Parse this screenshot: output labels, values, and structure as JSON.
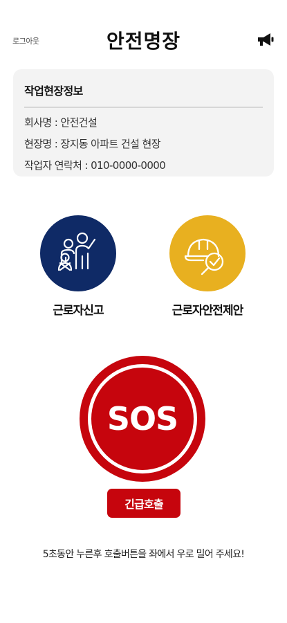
{
  "header": {
    "logout_label": "로그아웃",
    "title": "안전명장",
    "megaphone_icon": "megaphone-icon"
  },
  "info_card": {
    "title": "작업현장정보",
    "rows": [
      "회사명 : 안전건설",
      "현장명 : 장지동 아파트 건설 현장",
      "작업자 연락처 : 010-0000-0000"
    ]
  },
  "actions": {
    "report": {
      "label": "근로자신고",
      "icon": "workers-raising-hand-icon",
      "color": "#0f2a66"
    },
    "proposal": {
      "label": "근로자안전제안",
      "icon": "hardhat-checkmark-icon",
      "color": "#e8b020"
    }
  },
  "sos": {
    "label": "SOS",
    "button_label": "긴급호출",
    "color": "#c6050d"
  },
  "instruction": "5초동안 누른후 호출버튼을 좌에서 우로 밀어 주세요!"
}
